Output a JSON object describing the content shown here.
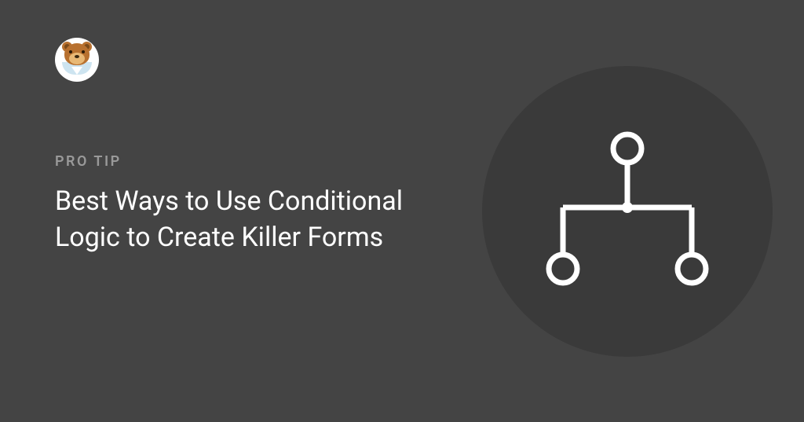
{
  "eyebrow": "PRO TIP",
  "title": "Best Ways to Use Conditional Logic to Create Killer Forms"
}
